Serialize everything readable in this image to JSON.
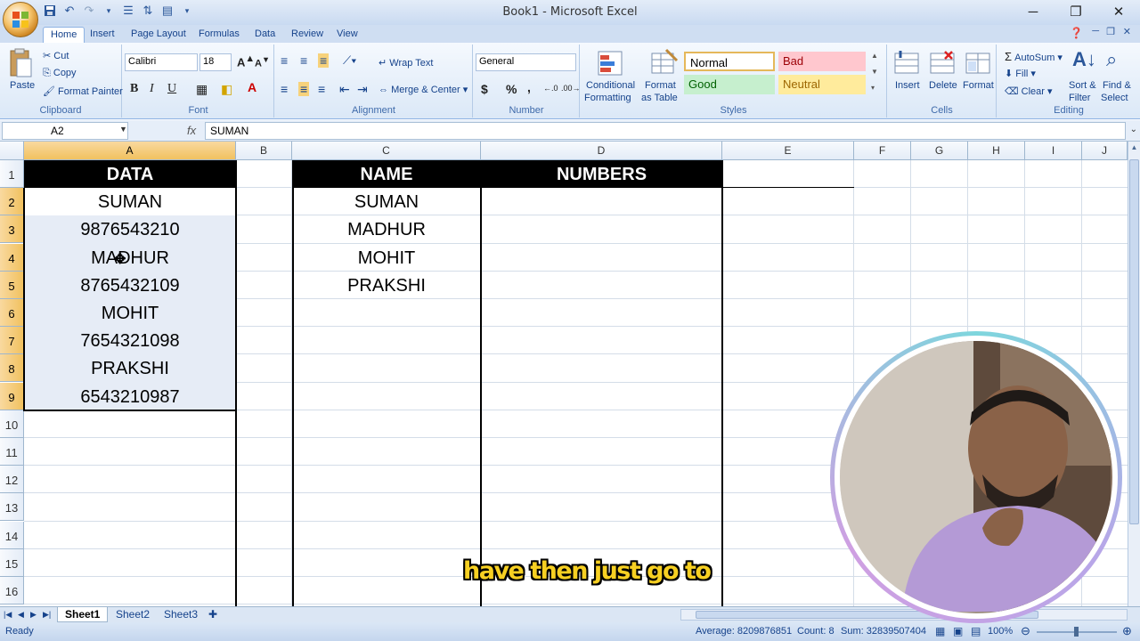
{
  "app": {
    "title": "Book1 - Microsoft Excel"
  },
  "qat": {
    "icons": [
      "save-icon",
      "undo-icon",
      "redo-icon",
      "quick-access-dropdown-icon"
    ]
  },
  "tabs": [
    "Home",
    "Insert",
    "Page Layout",
    "Formulas",
    "Data",
    "Review",
    "View"
  ],
  "ribbon": {
    "clipboard": {
      "paste": "Paste",
      "cut": "Cut",
      "copy": "Copy",
      "format_painter": "Format Painter",
      "label": "Clipboard"
    },
    "font": {
      "name": "Calibri",
      "size": "18",
      "label": "Font",
      "bold": "B",
      "italic": "I",
      "underline": "U"
    },
    "alignment": {
      "wrap": "Wrap Text",
      "merge": "Merge & Center",
      "label": "Alignment"
    },
    "number": {
      "format": "General",
      "currency": "$",
      "percent": "%",
      "comma": ",",
      "label": "Number"
    },
    "styles": {
      "conditional": "Conditional",
      "conditional2": "Formatting",
      "format_table": "Format",
      "format_table2": "as Table",
      "normal": "Normal",
      "bad": "Bad",
      "good": "Good",
      "neutral": "Neutral",
      "label": "Styles"
    },
    "cells": {
      "insert": "Insert",
      "delete": "Delete",
      "format": "Format",
      "label": "Cells"
    },
    "editing": {
      "autosum": "AutoSum",
      "fill": "Fill",
      "clear": "Clear",
      "sort": "Sort &",
      "sort2": "Filter",
      "find": "Find &",
      "find2": "Select",
      "label": "Editing"
    }
  },
  "formula_bar": {
    "name_box": "A2",
    "fx": "fx",
    "content": "SUMAN"
  },
  "columns": [
    "A",
    "B",
    "C",
    "D",
    "E",
    "F",
    "G",
    "H",
    "I",
    "J"
  ],
  "rows": [
    "1",
    "2",
    "3",
    "4",
    "5",
    "6",
    "7",
    "8",
    "9",
    "10",
    "11",
    "12",
    "13",
    "14",
    "15",
    "16"
  ],
  "table1": {
    "header": "DATA",
    "values": [
      "SUMAN",
      "9876543210",
      "MADHUR",
      "8765432109",
      "MOHIT",
      "7654321098",
      "PRAKSHI",
      "6543210987"
    ]
  },
  "table2": {
    "header_name": "NAME",
    "header_numbers": "NUMBERS",
    "names": [
      "SUMAN",
      "MADHUR",
      "MOHIT",
      "PRAKSHI"
    ]
  },
  "sheets": [
    "Sheet1",
    "Sheet2",
    "Sheet3"
  ],
  "status": {
    "ready": "Ready",
    "average": "Average: 8209876851",
    "count": "Count: 8",
    "sum": "Sum: 32839507404",
    "zoom": "100%"
  },
  "subtitle": "have then just go to"
}
